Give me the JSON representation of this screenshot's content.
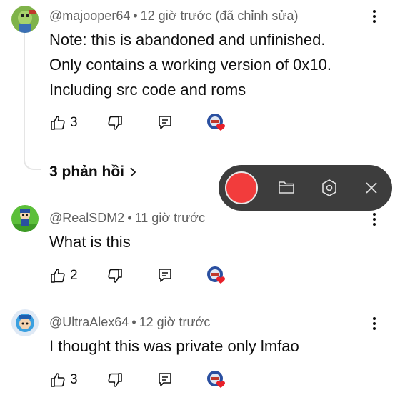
{
  "comments": [
    {
      "author": "@majooper64",
      "time": "12 giờ trước (đã chỉnh sửa)",
      "lines": [
        "Note: this is abandoned and unfinished.",
        "Only contains a working version of 0x10.",
        "Including src code and roms"
      ],
      "likes": "3",
      "avatar_color": "#7fb34a"
    },
    {
      "author": "@RealSDM2",
      "time": "11 giờ trước",
      "lines": [
        "What is this"
      ],
      "likes": "2",
      "avatar_color": "#5cbf3a"
    },
    {
      "author": "@UltraAlex64",
      "time": "12 giờ trước",
      "lines": [
        "I thought this was private only lmfao"
      ],
      "likes": "3",
      "avatar_color": "#dfe9f5"
    }
  ],
  "replies_link": {
    "label": "3 phản hồi",
    "chevron": "chevron-right-icon"
  },
  "separator": "•",
  "recorder_toolbar": {
    "record_color": "#f23c3c",
    "background": "#3d3d3d",
    "icons": [
      "record-button",
      "folder-icon",
      "settings-hex-icon",
      "close-icon"
    ]
  },
  "heart_color": "#e8202a"
}
